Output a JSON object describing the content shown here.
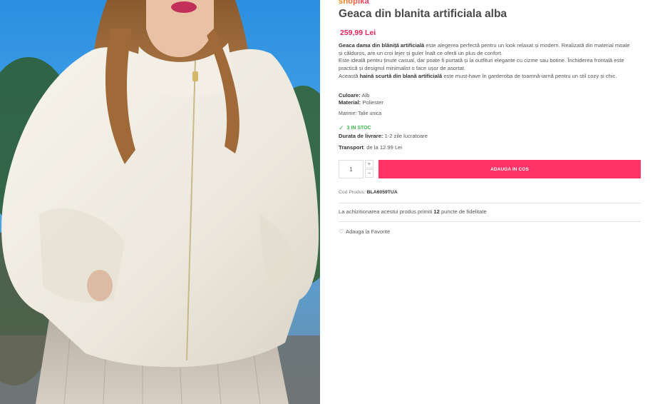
{
  "brand": {
    "name": "shopika"
  },
  "product": {
    "title": "Geaca din blanita artificiala alba",
    "price": "259,99 Lei",
    "description": [
      [
        {
          "t": "Geaca dama din blăniță artificială",
          "b": true
        },
        {
          "t": " este alegerea perfectă pentru un look relaxat și modern. Realizată din material moale și călduros, are un croi lejer și guler înalt ce oferă un plus de confort.",
          "b": false
        }
      ],
      [
        {
          "t": "Este ideală pentru ținute casual, dar poate fi purtată și la outfituri elegante cu cizme sau botine. Închiderea frontală este practică și designul minimalist o face ușor de asortat.",
          "b": false
        }
      ],
      [
        {
          "t": "Această ",
          "b": false
        },
        {
          "t": "haină scurtă din blană artificială",
          "b": true
        },
        {
          "t": " este must-have în garderoba de toamnă-iarnă pentru un stil cozy și chic.",
          "b": false
        }
      ]
    ],
    "color_label": "Culoare:",
    "color_value": " Alb",
    "material_label": "Material:",
    "material_value": " Poliester",
    "size_text": "Marime: Talie unica",
    "stock_text": "3 IN STOC",
    "delivery_label": "Durata de livrare:",
    "delivery_value": " 1-2 zile lucratoare",
    "transport_label": "Transport",
    "transport_value": ": de la 12.99 Lei"
  },
  "cart": {
    "quantity": "1",
    "plus": "+",
    "minus": "−",
    "add_label": "ADAUGA IN COS"
  },
  "sku": {
    "label": "Cod Produs: ",
    "value": "BLA6059TUA"
  },
  "loyalty": {
    "prefix": "La achizitionarea acestui produs primiti ",
    "points": "12",
    "suffix": " puncte de fidelitate"
  },
  "favorite": {
    "label": "Adauga la Favorite",
    "icon": "heart-icon"
  },
  "icons": {
    "stock": "check-icon",
    "favorite": "heart-icon"
  },
  "colors": {
    "accent": "#ff3366",
    "price": "#e8235a",
    "stock": "#3bb54a",
    "brand_start": "#ff8a00",
    "brand_end": "#e5336b"
  }
}
